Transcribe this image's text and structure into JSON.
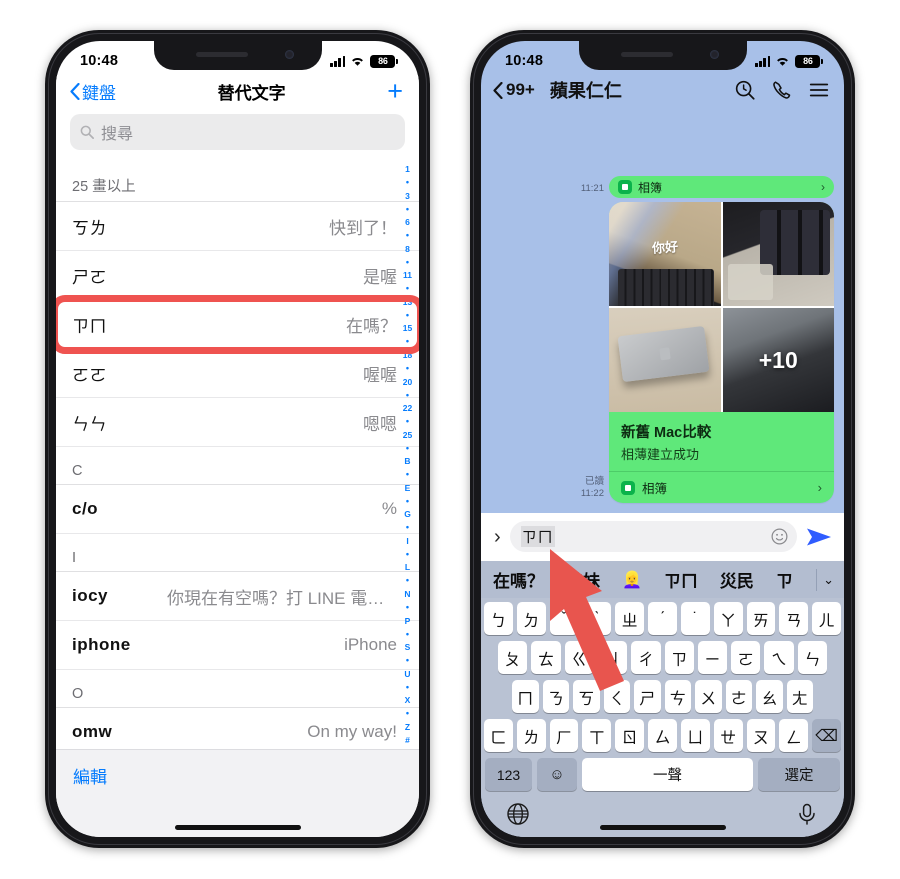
{
  "left_phone": {
    "status": {
      "time": "10:48",
      "battery": "86",
      "signal_icon": "cellular-bars-icon",
      "wifi_icon": "wifi-icon"
    },
    "nav": {
      "back_label": "鍵盤",
      "title": "替代文字",
      "add_label": "+"
    },
    "search": {
      "placeholder": "搜尋",
      "icon": "search-icon"
    },
    "groups": [
      {
        "header": "25 畫以上",
        "rows": [
          {
            "shortcut": "ㄎㄌ",
            "phrase": "快到了！"
          },
          {
            "shortcut": "ㄕㄛ",
            "phrase": "是喔"
          },
          {
            "shortcut": "ㄗㄇ",
            "phrase": "在嗎？",
            "highlighted": true
          },
          {
            "shortcut": "ㄛㄛ",
            "phrase": "喔喔"
          },
          {
            "shortcut": "ㄣㄣ",
            "phrase": "嗯嗯"
          }
        ]
      },
      {
        "header": "C",
        "rows": [
          {
            "shortcut": "c/o",
            "phrase": "%"
          }
        ]
      },
      {
        "header": "I",
        "rows": [
          {
            "shortcut": "iocy",
            "phrase": "你現在有空嗎？打 LINE 電話給你…"
          },
          {
            "shortcut": "iphone",
            "phrase": "iPhone"
          }
        ]
      },
      {
        "header": "O",
        "rows": [
          {
            "shortcut": "omw",
            "phrase": "On my way!"
          }
        ]
      }
    ],
    "index_bar": [
      "1",
      "•",
      "3",
      "•",
      "6",
      "•",
      "8",
      "•",
      "11",
      "•",
      "13",
      "•",
      "15",
      "•",
      "18",
      "•",
      "20",
      "•",
      "22",
      "•",
      "25",
      "•",
      "B",
      "•",
      "E",
      "•",
      "G",
      "•",
      "I",
      "•",
      "L",
      "•",
      "N",
      "•",
      "P",
      "•",
      "S",
      "•",
      "U",
      "•",
      "X",
      "•",
      "Z",
      "#"
    ],
    "footer": {
      "edit_label": "編輯"
    }
  },
  "right_phone": {
    "status": {
      "time": "10:48",
      "battery": "86",
      "signal_icon": "cellular-bars-icon",
      "wifi_icon": "wifi-icon"
    },
    "nav": {
      "back_count": "99+",
      "title": "蘋果仁仁",
      "icons": [
        "search-history-icon",
        "phone-call-icon",
        "hamburger-menu-icon"
      ]
    },
    "messages": [
      {
        "time": "11:21",
        "type": "album-stub",
        "album_label": "相簿"
      },
      {
        "time": "11:22",
        "read_label": "已讀",
        "type": "album-card",
        "title": "新舊 Mac比較",
        "subtitle": "相薄建立成功",
        "album_label": "相簿",
        "photo_overlay": "+10",
        "photo_count_cells": 4,
        "photo_caption": "你好"
      }
    ],
    "input_bar": {
      "expand_icon": "chevron-right-icon",
      "value": "ㄗㄇ",
      "emoji_icon": "smiley-icon",
      "send_icon": "send-arrow-icon"
    },
    "candidates": {
      "items": [
        "在嗎？",
        "姊妹",
        "👱‍♀️",
        "ㄗㄇ",
        "災民",
        "ㄗ"
      ],
      "expand_icon": "chevron-down-icon"
    },
    "keyboard": {
      "rows": [
        [
          "ㄅ",
          "ㄉ",
          "ˇ",
          "ˋ",
          "ㄓ",
          "ˊ",
          "˙",
          "ㄚ",
          "ㄞ",
          "ㄢ",
          "ㄦ"
        ],
        [
          "ㄆ",
          "ㄊ",
          "ㄍ",
          "ㄐ",
          "ㄔ",
          "ㄗ",
          "ㄧ",
          "ㄛ",
          "ㄟ",
          "ㄣ"
        ],
        [
          "ㄇ",
          "ㄋ",
          "ㄎ",
          "ㄑ",
          "ㄕ",
          "ㄘ",
          "ㄨ",
          "ㄜ",
          "ㄠ",
          "ㄤ"
        ],
        [
          "ㄈ",
          "ㄌ",
          "ㄏ",
          "ㄒ",
          "ㄖ",
          "ㄙ",
          "ㄩ",
          "ㄝ",
          "ㄡ",
          "ㄥ",
          "⌫"
        ]
      ],
      "bottom_row": {
        "num_label": "123",
        "emoji_label": "☺",
        "space_label": "一聲",
        "select_label": "選定"
      },
      "globe_icon": "globe-icon",
      "mic_icon": "microphone-icon"
    }
  },
  "annotations": {
    "highlight_color": "#ef5350",
    "arrow_color": "#e8554e",
    "highlight_target": "ㄗㄇ 在嗎？",
    "arrow_target": "在嗎？"
  }
}
